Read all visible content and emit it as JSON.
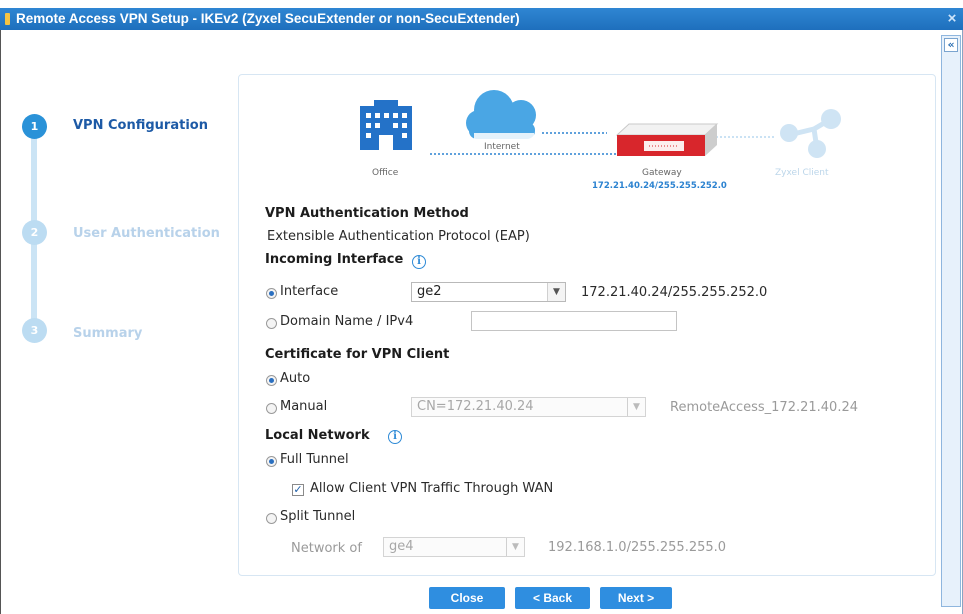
{
  "window": {
    "title": "Remote Access VPN Setup - IKEv2 (Zyxel SecuExtender or non-SecuExtender)",
    "close_glyph": "×"
  },
  "help_panel": {
    "toggle_glyph": "«"
  },
  "steps": [
    {
      "number": "1",
      "label": "VPN Configuration",
      "state": "active"
    },
    {
      "number": "2",
      "label": "User Authentication",
      "state": "inactive"
    },
    {
      "number": "3",
      "label": "Summary",
      "state": "inactive"
    }
  ],
  "topology": {
    "office_label": "Office",
    "internet_label": "Internet",
    "gateway_label": "Gateway",
    "gateway_address": "172.21.40.24/255.255.252.0",
    "client_label": "Zyxel Client",
    "icons": [
      "building-icon",
      "cloud-icon",
      "firewall-appliance-icon",
      "client-share-icon"
    ]
  },
  "auth_method": {
    "heading": "VPN Authentication Method",
    "value": "Extensible Authentication Protocol (EAP)"
  },
  "incoming_interface": {
    "heading": "Incoming Interface",
    "interface_option": {
      "label": "Interface",
      "selected": true,
      "value": "ge2",
      "address": "172.21.40.24/255.255.252.0"
    },
    "domain_option": {
      "label": "Domain Name / IPv4",
      "selected": false,
      "value": ""
    }
  },
  "certificate": {
    "heading": "Certificate for VPN Client",
    "auto_option": {
      "label": "Auto",
      "selected": true
    },
    "manual_option": {
      "label": "Manual",
      "selected": false,
      "value": "CN=172.21.40.24",
      "name": "RemoteAccess_172.21.40.24"
    }
  },
  "local_network": {
    "heading": "Local Network",
    "full_tunnel": {
      "label": "Full Tunnel",
      "selected": true
    },
    "allow_wan": {
      "label": "Allow Client VPN Traffic Through WAN",
      "checked": true
    },
    "split_tunnel": {
      "label": "Split Tunnel",
      "selected": false
    },
    "network_of": {
      "label": "Network of",
      "value": "ge4",
      "address": "192.168.1.0/255.255.255.0"
    }
  },
  "buttons": {
    "close": "Close",
    "back": "< Back",
    "next": "Next >"
  },
  "colors": {
    "title_bar": "#1e6fbd",
    "accent": "#2f8ee0",
    "step_active": "#2a92d8",
    "step_inactive": "#bcdcf2",
    "firewall_red": "#d8262c"
  }
}
